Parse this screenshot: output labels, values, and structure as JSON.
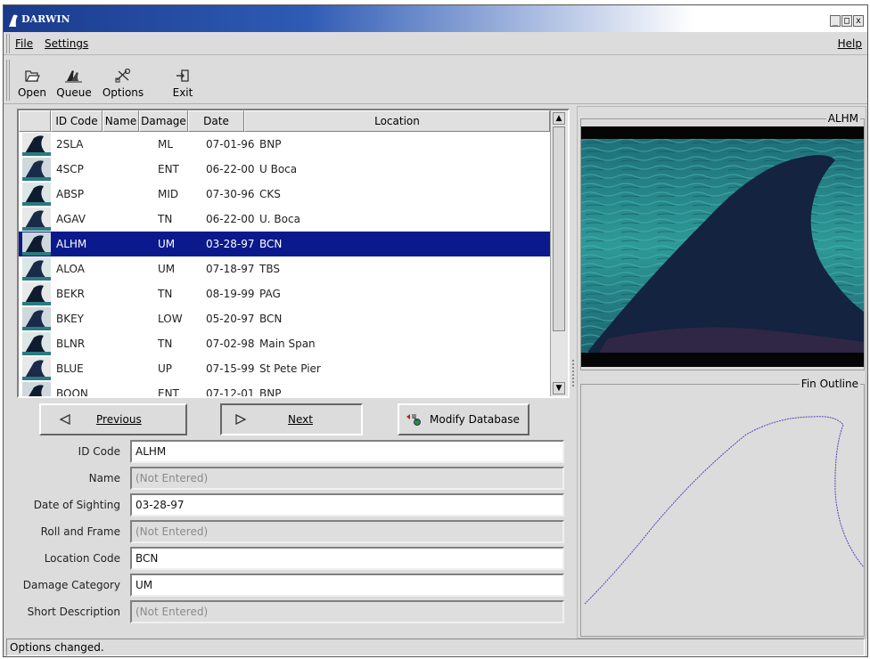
{
  "window": {
    "title": "DARWIN",
    "min": "_",
    "max": "□",
    "close": "x"
  },
  "menu": {
    "file": "File",
    "settings": "Settings",
    "help": "Help"
  },
  "toolbar": {
    "open": "Open",
    "queue": "Queue",
    "options": "Options",
    "exit": "Exit"
  },
  "table": {
    "headers": [
      "ID Code",
      "Name",
      "Damage",
      "Date",
      "Location"
    ],
    "rows": [
      {
        "id": "2SLA",
        "name": "",
        "damage": "ML",
        "date": "07-01-96",
        "location": "BNP"
      },
      {
        "id": "4SCP",
        "name": "",
        "damage": "ENT",
        "date": "06-22-00",
        "location": "U Boca"
      },
      {
        "id": "ABSP",
        "name": "",
        "damage": "MID",
        "date": "07-30-96",
        "location": "CKS"
      },
      {
        "id": "AGAV",
        "name": "",
        "damage": "TN",
        "date": "06-22-00",
        "location": "U. Boca"
      },
      {
        "id": "ALHM",
        "name": "",
        "damage": "UM",
        "date": "03-28-97",
        "location": "BCN"
      },
      {
        "id": "ALOA",
        "name": "",
        "damage": "UM",
        "date": "07-18-97",
        "location": "TBS"
      },
      {
        "id": "BEKR",
        "name": "",
        "damage": "TN",
        "date": "08-19-99",
        "location": "PAG"
      },
      {
        "id": "BKEY",
        "name": "",
        "damage": "LOW",
        "date": "05-20-97",
        "location": "BCN"
      },
      {
        "id": "BLNR",
        "name": "",
        "damage": "TN",
        "date": "07-02-98",
        "location": "Main Span"
      },
      {
        "id": "BLUE",
        "name": "",
        "damage": "UP",
        "date": "07-15-99",
        "location": "St Pete Pier"
      },
      {
        "id": "BOON",
        "name": "",
        "damage": "ENT",
        "date": "07-12-01",
        "location": "BNP"
      }
    ],
    "selected_index": 4
  },
  "buttons": {
    "previous": "Previous",
    "next": "Next",
    "modify": "Modify Database"
  },
  "form": [
    {
      "label": "ID Code",
      "value": "ALHM",
      "disabled": false
    },
    {
      "label": "Name",
      "value": "(Not Entered)",
      "disabled": true
    },
    {
      "label": "Date of Sighting",
      "value": "03-28-97",
      "disabled": false
    },
    {
      "label": "Roll and Frame",
      "value": "(Not Entered)",
      "disabled": true
    },
    {
      "label": "Location Code",
      "value": "BCN",
      "disabled": false
    },
    {
      "label": "Damage Category",
      "value": "UM",
      "disabled": false
    },
    {
      "label": "Short Description",
      "value": "(Not Entered)",
      "disabled": true
    }
  ],
  "right_panel": {
    "image_label": "ALHM",
    "outline_label": "Fin Outline"
  },
  "status": "Options changed.",
  "colors": {
    "selection": "#0a1a8c",
    "outline": "#5a3fc0",
    "water": "#2a8a8c"
  }
}
